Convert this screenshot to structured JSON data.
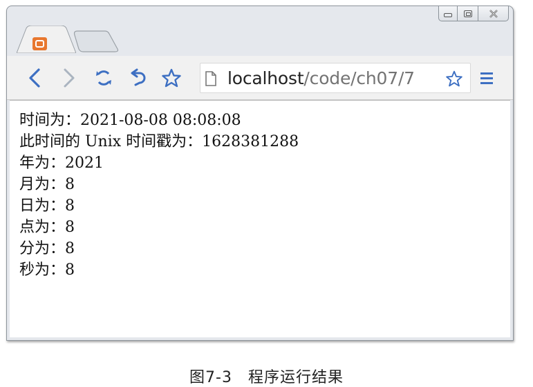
{
  "browser": {
    "address_bar": {
      "host": "localhost",
      "path": "/code/ch07/7"
    },
    "icons": {
      "back": "back-arrow-icon",
      "forward": "forward-arrow-icon",
      "reload": "reload-icon",
      "undo": "undo-icon",
      "bookmark": "star-icon",
      "page": "page-icon",
      "menu": "hamburger-menu-icon",
      "favicon": "xampp-favicon-icon"
    },
    "colors": {
      "nav_icon": "#3d6fc2",
      "favicon": "#e8772e"
    }
  },
  "page": {
    "lines": [
      "时间为：2021-08-08 08:08:08",
      "此时间的 Unix 时间戳为：1628381288",
      "年为：2021",
      "月为：8",
      "日为：8",
      "点为：8",
      "分为：8",
      "秒为：8"
    ]
  },
  "caption": "图7-3　程序运行结果"
}
